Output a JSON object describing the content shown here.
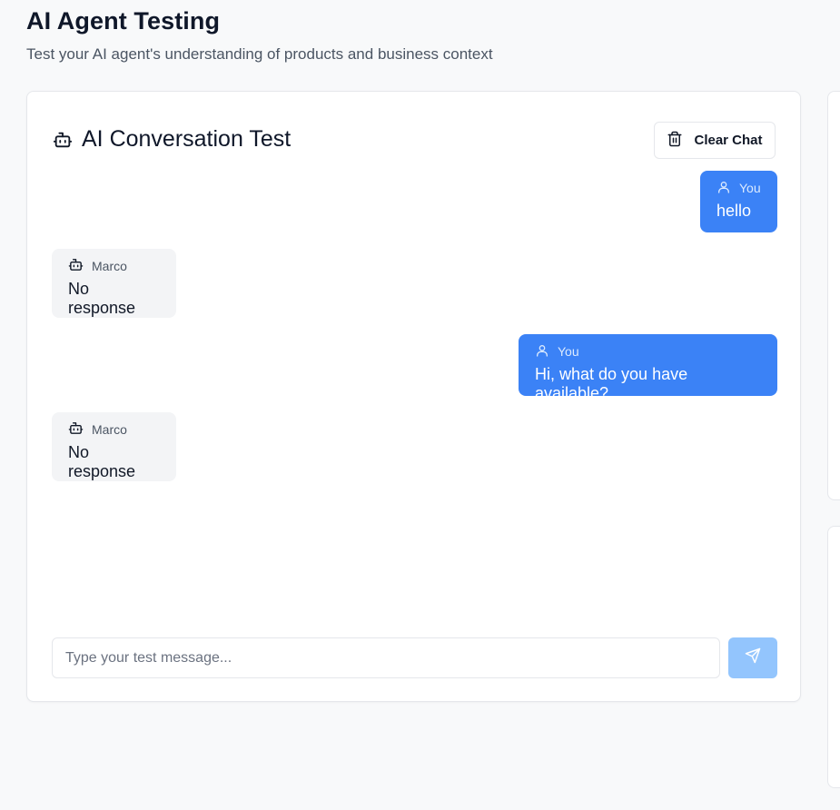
{
  "header": {
    "title": "AI Agent Testing",
    "subtitle": "Test your AI agent's understanding of products and business context"
  },
  "chat": {
    "title": "AI Conversation Test",
    "clear_label": "Clear Chat",
    "messages": [
      {
        "role": "user",
        "sender": "You",
        "text": "hello"
      },
      {
        "role": "bot",
        "sender": "Marco",
        "text": "No response"
      },
      {
        "role": "user",
        "sender": "You",
        "text": "Hi, what do you have available?"
      },
      {
        "role": "bot",
        "sender": "Marco",
        "text": "No response"
      }
    ],
    "input": {
      "value": "",
      "placeholder": "Type your test message..."
    }
  },
  "icons": {
    "title": "bot-icon",
    "clear": "trash-icon",
    "user": "user-icon",
    "bot": "bot-icon",
    "send": "send-icon"
  },
  "colors": {
    "user_bubble": "#3b82f6",
    "bot_bubble": "#f3f4f6",
    "send_button_disabled": "#93c5fd",
    "page_background": "#f8f9fa"
  }
}
